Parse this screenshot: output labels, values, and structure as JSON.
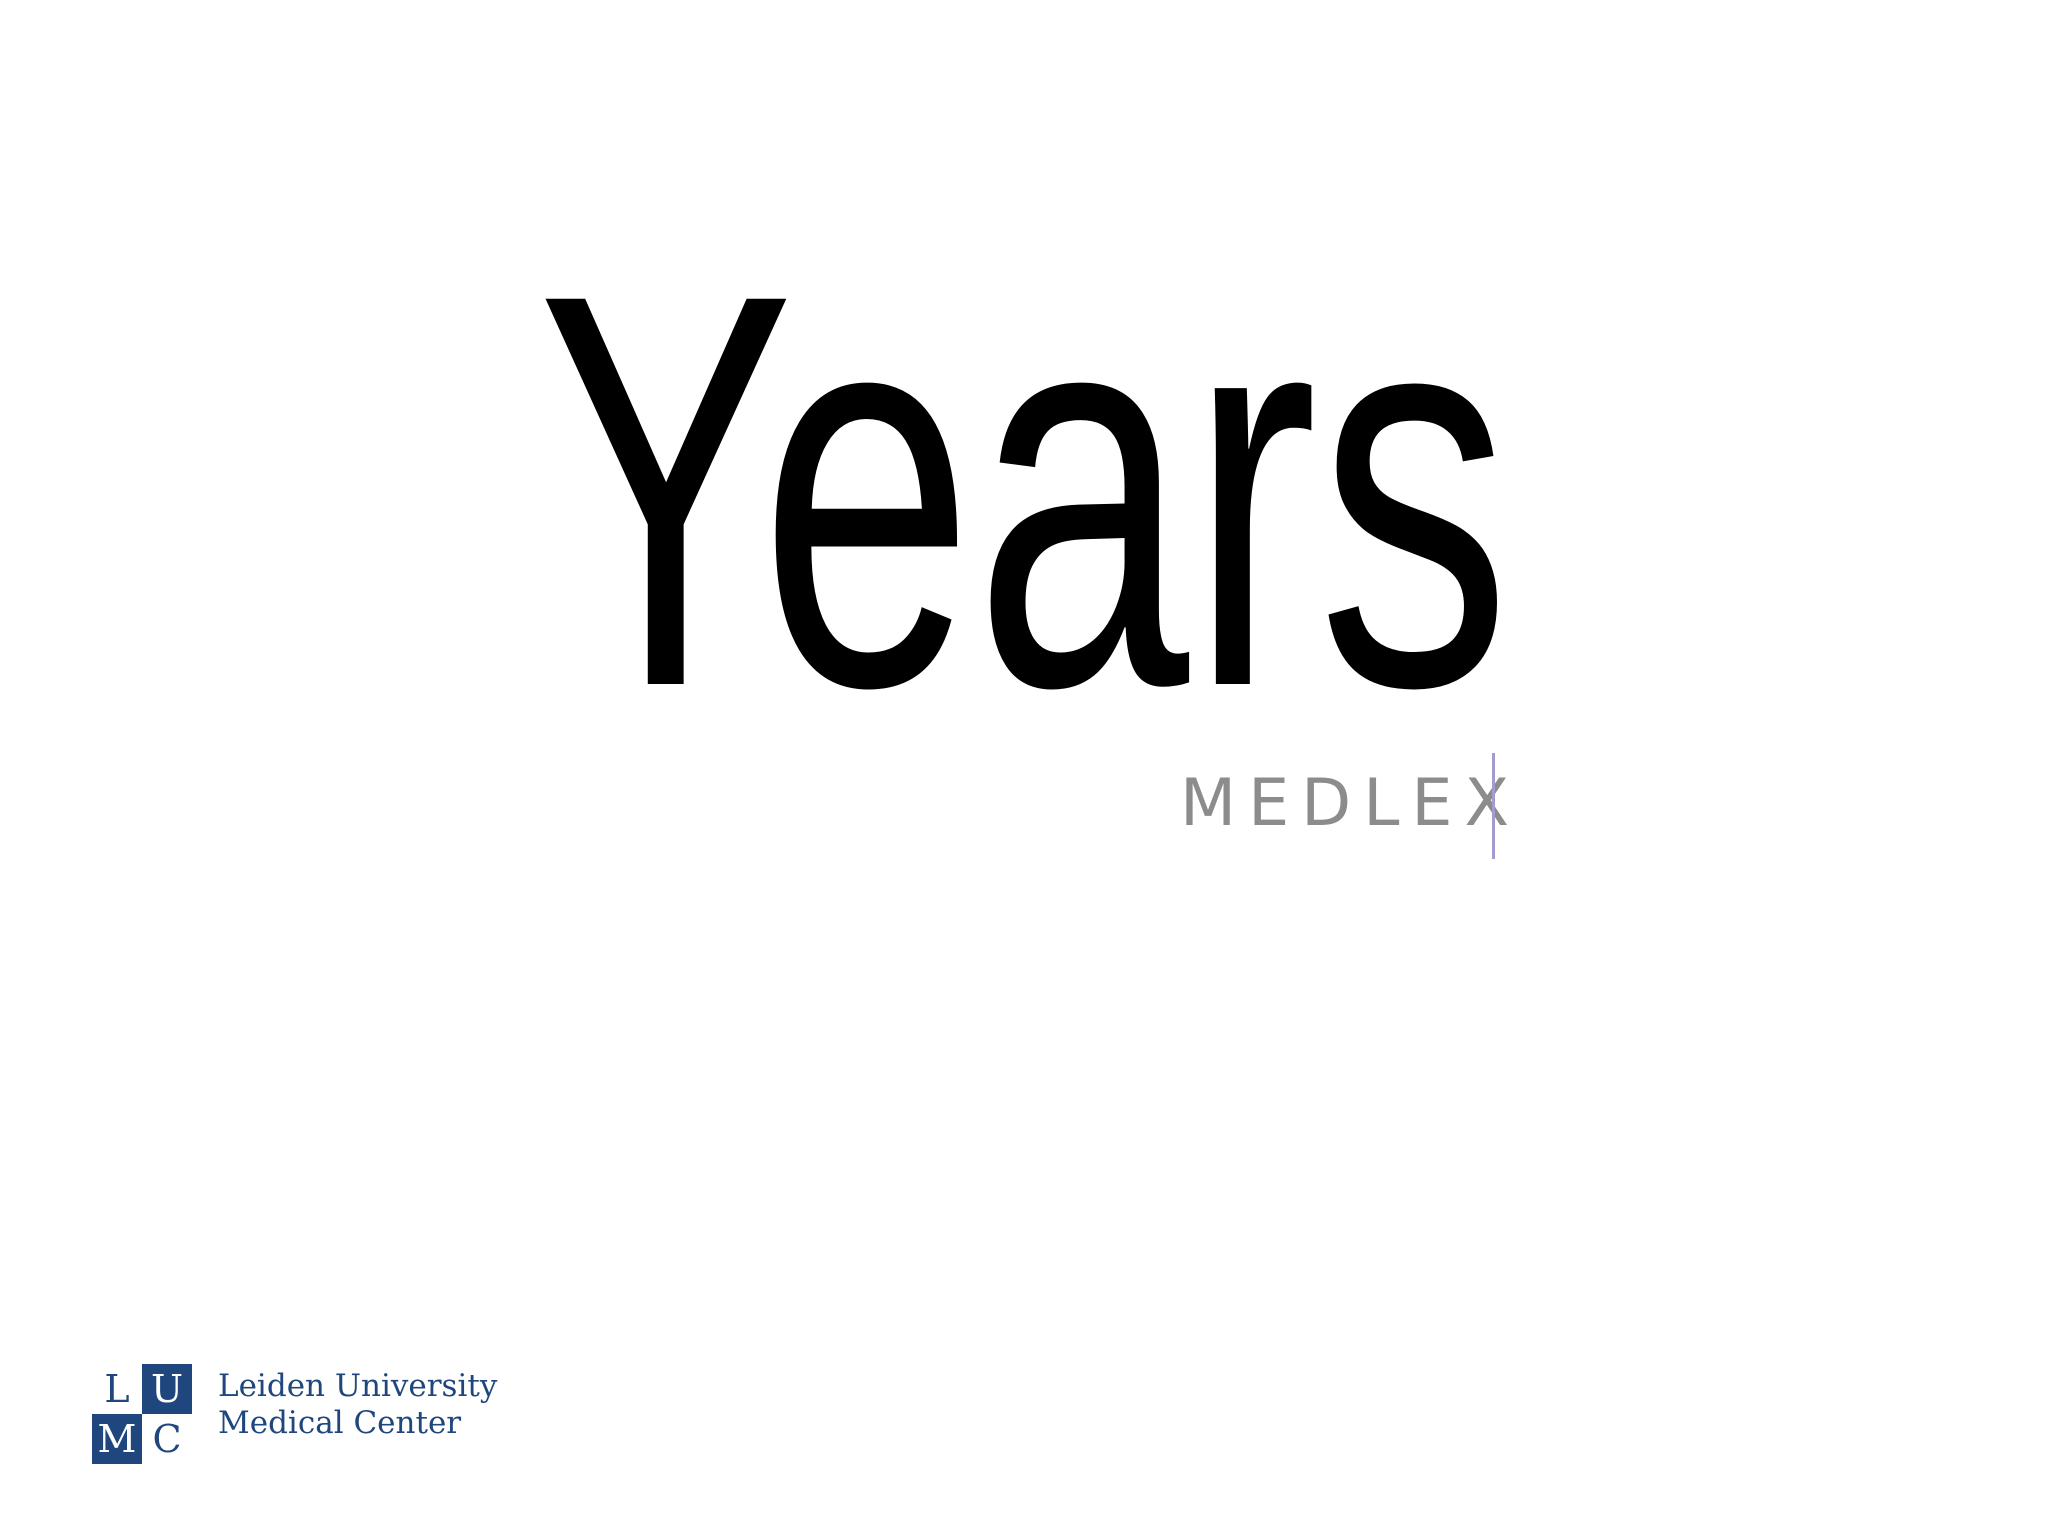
{
  "slide": {
    "title": "Years",
    "brand": "MEDLEX",
    "organization": {
      "logo_letters": [
        "L",
        "U",
        "M",
        "C"
      ],
      "name_line_1": "Leiden University",
      "name_line_2": "Medical Center",
      "brand_color": "#1f477d"
    },
    "colors": {
      "title": "#000000",
      "brand_text": "#8c8c8c",
      "divider": "#a19dcf",
      "background": "#ffffff"
    }
  }
}
